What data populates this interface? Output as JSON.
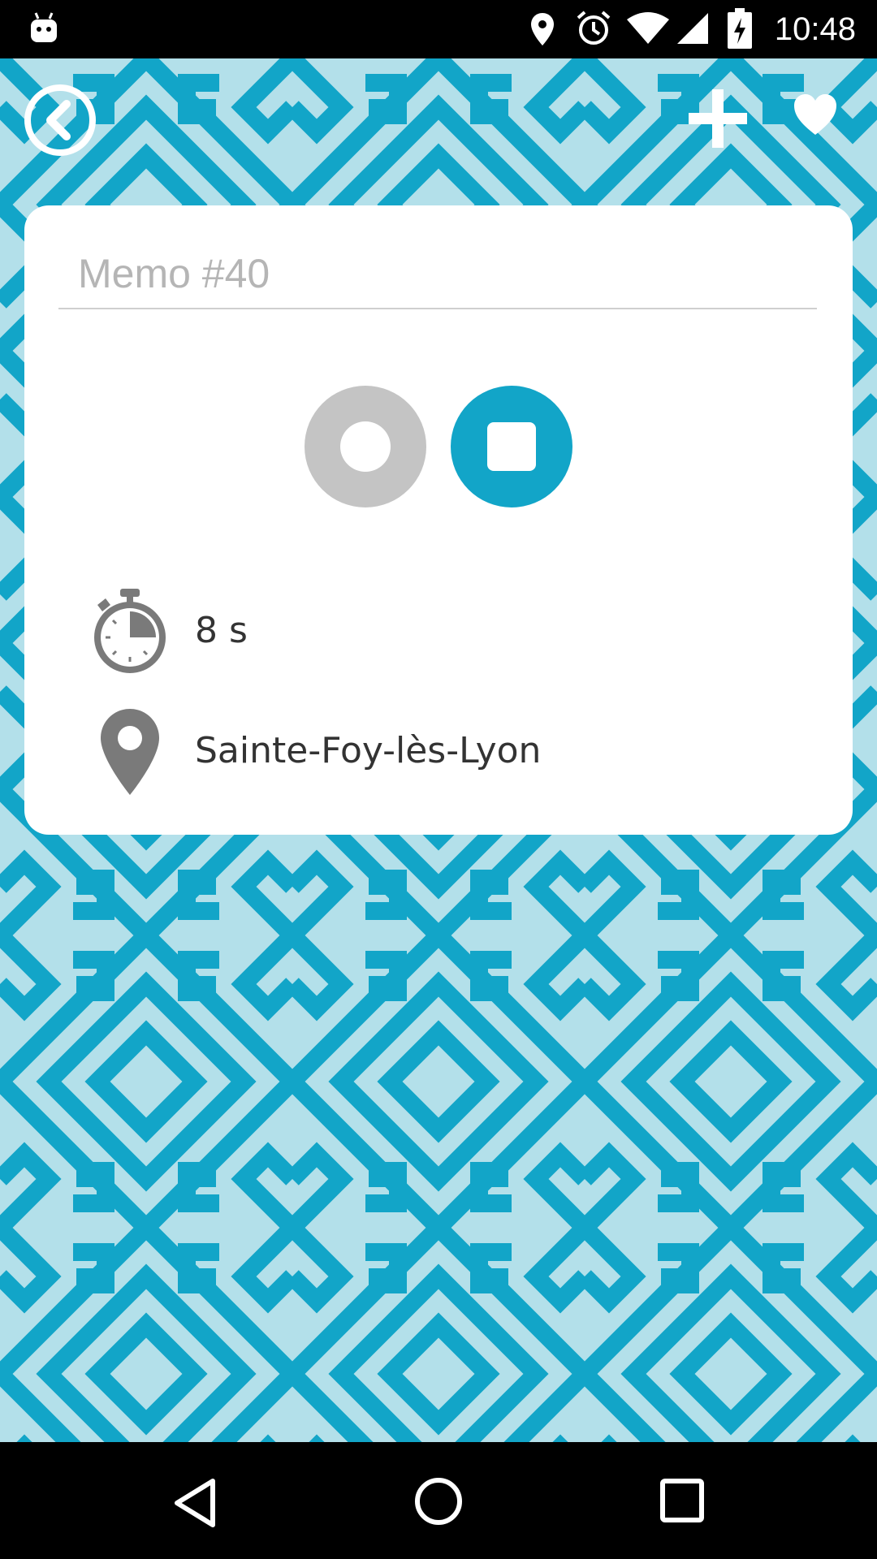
{
  "status_bar": {
    "time": "10:48",
    "icons": [
      "android-debug-icon",
      "location-icon",
      "alarm-icon",
      "wifi-icon",
      "cell-signal-icon",
      "battery-charging-icon"
    ]
  },
  "toolbar": {
    "back_icon": "back-circle-icon",
    "add_icon": "plus-icon",
    "favorite_icon": "heart-icon"
  },
  "memo": {
    "title_placeholder": "Memo #40",
    "title_value": "",
    "duration": "8 s",
    "location": "Sainte-Foy-lès-Lyon"
  },
  "controls": {
    "record_icon": "record-icon",
    "stop_icon": "stop-icon"
  },
  "nav_bar": {
    "icons": [
      "back-triangle-icon",
      "home-circle-icon",
      "recents-square-icon"
    ]
  },
  "colors": {
    "accent": "#12a5c8",
    "pattern_light": "#b3e0ea",
    "pattern_dark": "#12a5c8",
    "record_gray": "#c4c4c4",
    "icon_gray": "#7a7a7a"
  }
}
